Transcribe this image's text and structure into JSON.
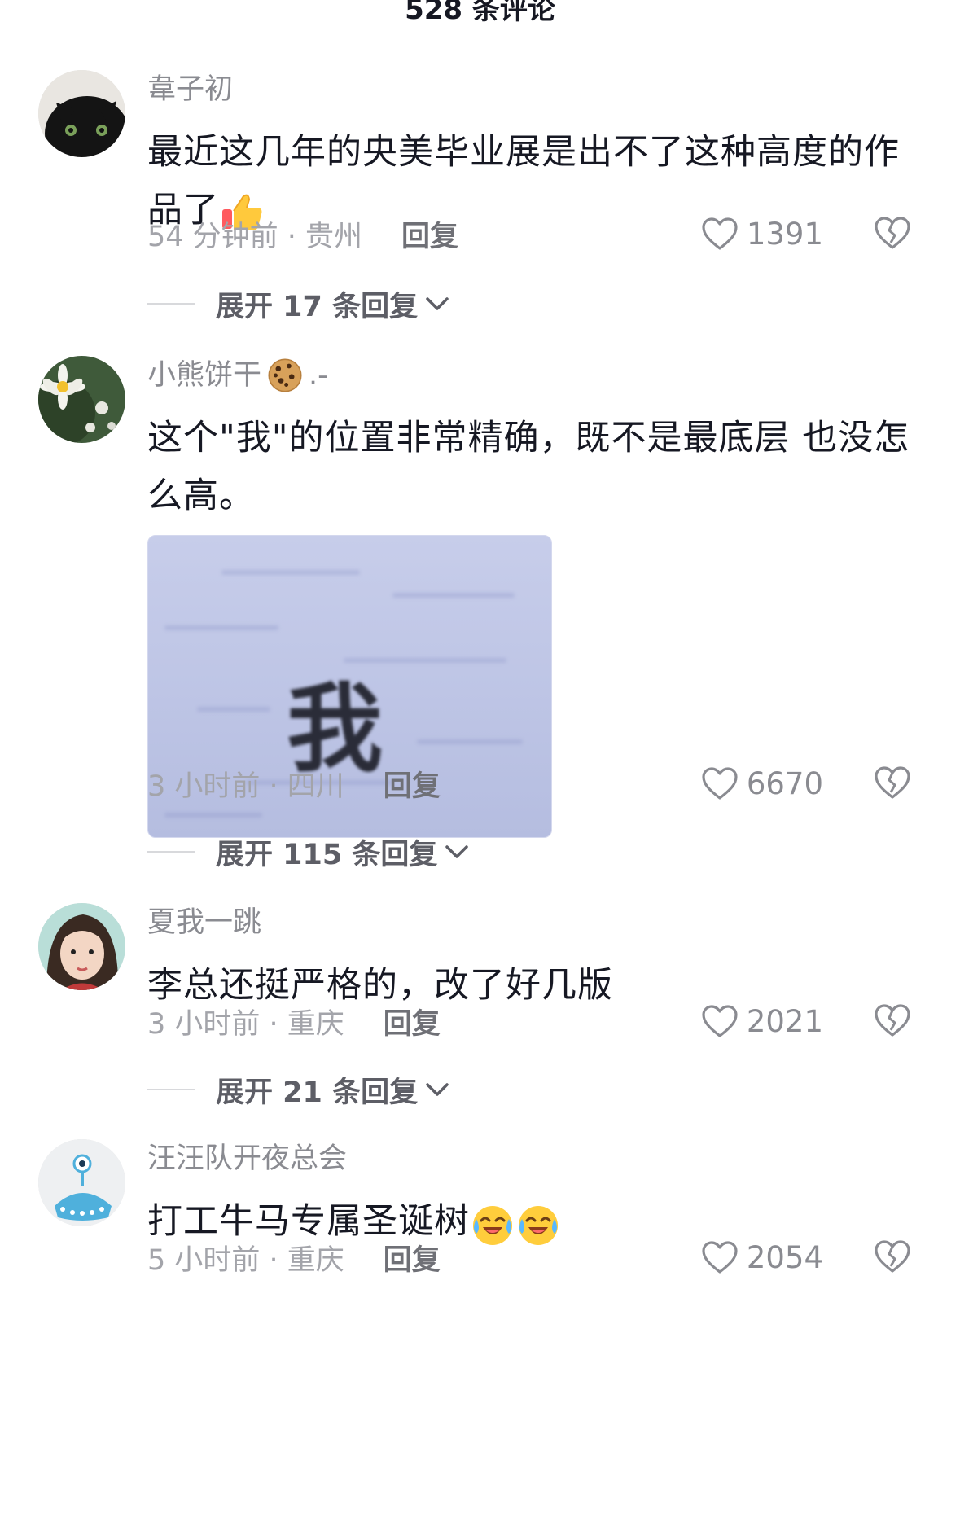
{
  "header": {
    "title": "528 条评论"
  },
  "comments": [
    {
      "username": "韋子初",
      "username_suffix": "",
      "text": "最近这几年的央美毕业展是出不了这种高度的作品了",
      "emoji": "thumbs-up-icon",
      "time": "54 分钟前 · 贵州",
      "reply": "回复",
      "likes": "1391",
      "expand": "展开 17 条回复"
    },
    {
      "username": "小熊饼干",
      "username_suffix": ".-",
      "text": "这个\"我\"的位置非常精确，既不是最底层 也没怎么高。",
      "image_text": "我",
      "time": "3 小时前 · 四川",
      "reply": "回复",
      "likes": "6670",
      "expand": "展开 115 条回复"
    },
    {
      "username": "夏我一跳",
      "username_suffix": "",
      "text": "李总还挺严格的，改了好几版",
      "time": "3 小时前 · 重庆",
      "reply": "回复",
      "likes": "2021",
      "expand": "展开 21 条回复"
    },
    {
      "username": "汪汪队开夜总会",
      "username_suffix": "",
      "text": "打工牛马专属圣诞树",
      "emoji": "laugh-cry-icon",
      "time": "5 小时前 · 重庆",
      "reply": "回复",
      "likes": "2054"
    }
  ]
}
